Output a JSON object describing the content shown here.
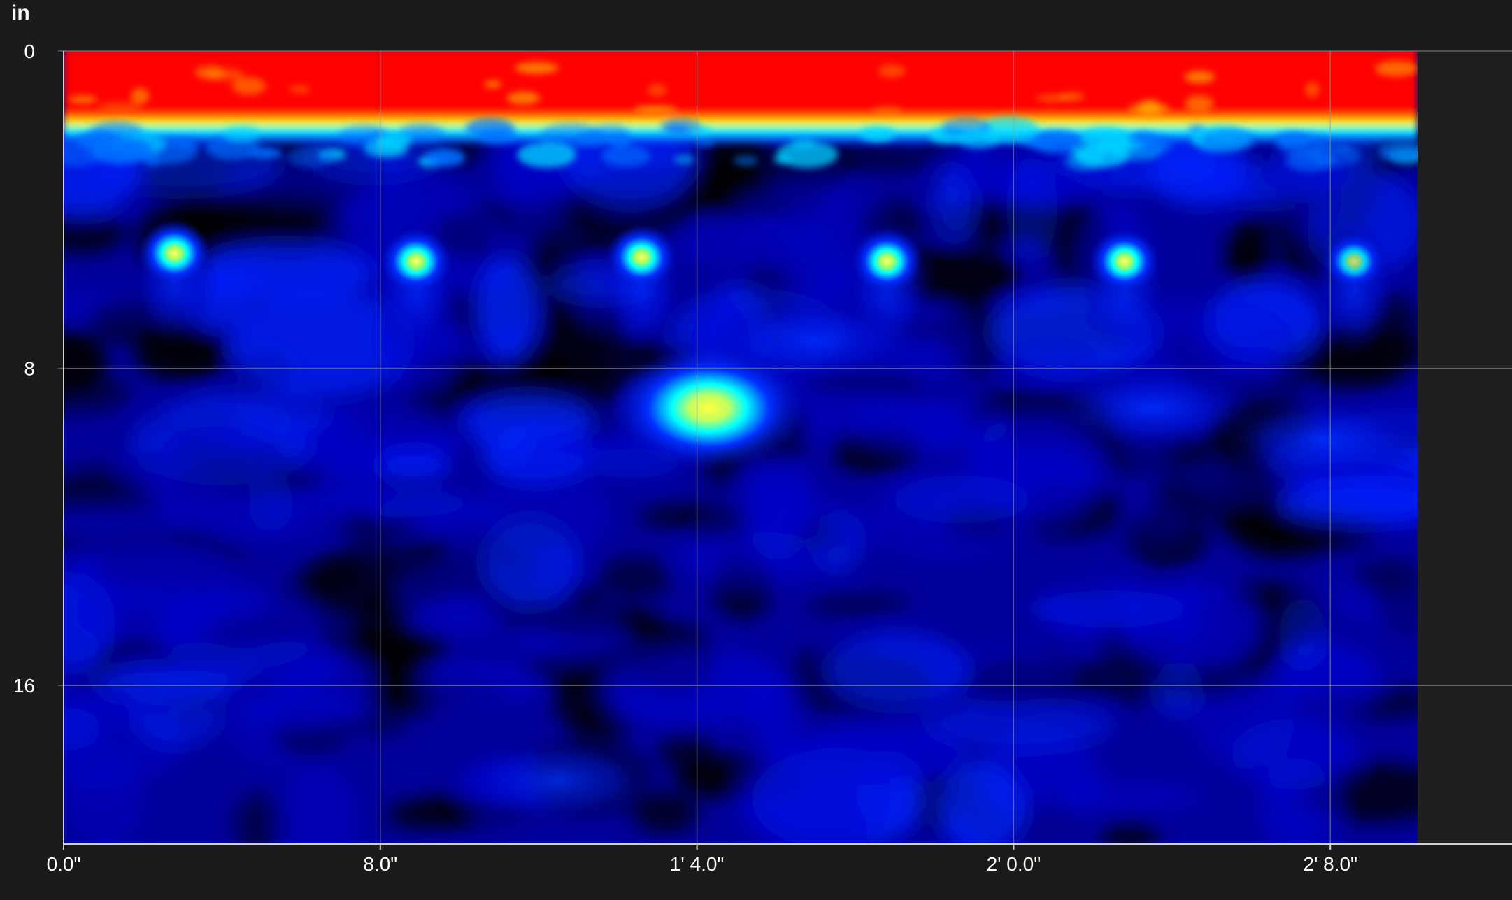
{
  "unit_label": "in",
  "chart_data": {
    "type": "heatmap",
    "title": "",
    "xlabel": "",
    "ylabel": "in",
    "x_unit": "in",
    "y_unit": "in",
    "xlim": [
      0,
      34.2
    ],
    "ylim": [
      0,
      20
    ],
    "x_ticks": [
      {
        "value": 0,
        "label": "0.0\""
      },
      {
        "value": 8,
        "label": "8.0\""
      },
      {
        "value": 16,
        "label": "1' 4.0\""
      },
      {
        "value": 24,
        "label": "2' 0.0\""
      },
      {
        "value": 32,
        "label": "2' 8.0\""
      }
    ],
    "y_ticks": [
      {
        "value": 0,
        "label": "0"
      },
      {
        "value": 8,
        "label": "8"
      },
      {
        "value": 16,
        "label": "16"
      }
    ],
    "grid": true,
    "colormap": [
      "#000000",
      "#0000c8",
      "#0018ff",
      "#00ffff",
      "#ffff00",
      "#ff0000"
    ],
    "surface_band": {
      "y_from": 0,
      "y_to": 1.7,
      "intensity": 1.0
    },
    "hyperbola_targets": [
      {
        "x": 2.8,
        "y": 5.1,
        "intensity": 0.66
      },
      {
        "x": 8.9,
        "y": 5.3,
        "intensity": 0.65
      },
      {
        "x": 14.6,
        "y": 5.2,
        "intensity": 0.62
      },
      {
        "x": 20.8,
        "y": 5.3,
        "intensity": 0.64
      },
      {
        "x": 26.8,
        "y": 5.3,
        "intensity": 0.63
      },
      {
        "x": 32.6,
        "y": 5.3,
        "intensity": 0.42
      }
    ],
    "reflections": [
      {
        "x": 16.3,
        "y": 9.0,
        "intensity": 0.72
      },
      {
        "x": 27.5,
        "y": 9.0,
        "intensity": 0.36
      },
      {
        "x": 31.8,
        "y": 9.8,
        "intensity": 0.34
      },
      {
        "x": 19.0,
        "y": 7.3,
        "intensity": 0.28
      },
      {
        "x": 12.5,
        "y": 18.4,
        "intensity": 0.3
      }
    ],
    "data_extent_x": 34.2,
    "right_area_color": "#1f1f1f"
  }
}
